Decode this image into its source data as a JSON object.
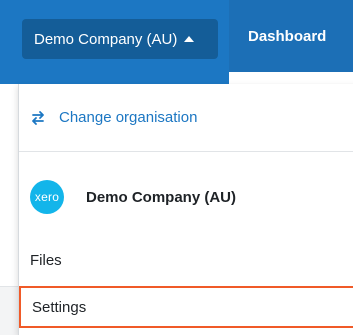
{
  "header": {
    "org_button_label": "Demo Company (AU)",
    "dashboard_tab_label": "Dashboard"
  },
  "menu": {
    "change_org_label": "Change organisation",
    "logo_text": "xero",
    "company_name": "Demo Company (AU)",
    "files_label": "Files",
    "settings_label": "Settings"
  },
  "colors": {
    "header_blue": "#1c77c3",
    "org_button_bg": "#145d98",
    "link_blue": "#1c77c3",
    "xero_logo": "#13b5ea",
    "focus_outline": "#f05a28"
  },
  "icons": {
    "org_caret": "caret-up-icon",
    "change_org": "swap-arrows-icon"
  }
}
